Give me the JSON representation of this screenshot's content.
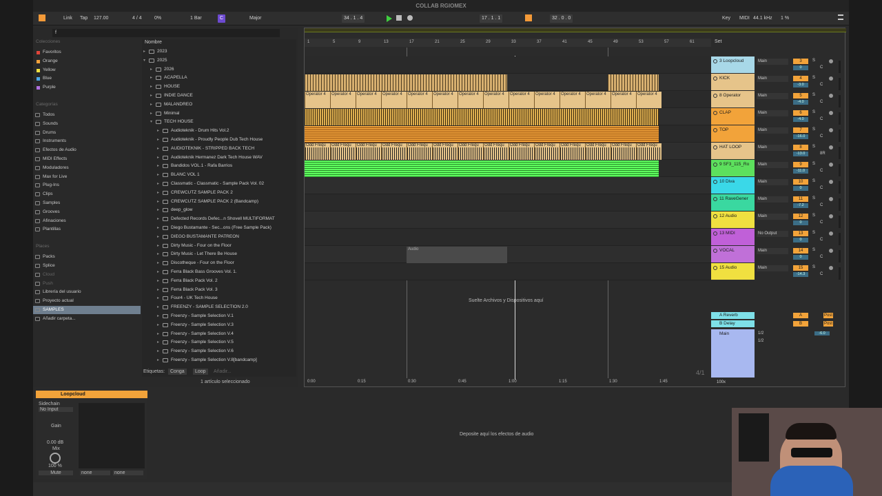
{
  "title": "COLLAB RGIOMEX",
  "control": {
    "link": "Link",
    "tap": "Tap",
    "tempo": "127.00",
    "sig": "4 / 4",
    "pct": "0%",
    "bar": "1 Bar",
    "key_root": "C",
    "scale": "Major",
    "pos": "34 .   1 .   4",
    "loop_start": "17 .   1 .   1",
    "loop_len": "32 .   0 .   0",
    "key": "Key",
    "midi": "MIDI",
    "rate": "44.1 kHz",
    "cpu": "1 %"
  },
  "browser": {
    "collections_title": "Colecciones",
    "collections": [
      {
        "label": "Favoritos",
        "color": "#e0453a"
      },
      {
        "label": "Orange",
        "color": "#f3a23b"
      },
      {
        "label": "Yellow",
        "color": "#f0e040"
      },
      {
        "label": "Blue",
        "color": "#4aa8e8"
      },
      {
        "label": "Purple",
        "color": "#b070e0"
      }
    ],
    "categories_title": "Categorías",
    "categories": [
      "Todos",
      "Sounds",
      "Drums",
      "Instruments",
      "Efectos de Audio",
      "MIDI Effects",
      "Moduladores",
      "Max for Live",
      "Plug-Ins",
      "Clips",
      "Samples",
      "Grooves",
      "Afinaciones",
      "Plantillas"
    ],
    "places_title": "Places",
    "places": [
      "Packs",
      "Splice",
      "Cloud",
      "Push",
      "Librería del usuario",
      "Proyecto actual",
      "SAMPLES",
      "Añadir carpeta..."
    ],
    "search_value": "f",
    "col_name": "Nombre",
    "tree": [
      {
        "t": "2023",
        "d": 0
      },
      {
        "t": "2025",
        "d": 0,
        "o": 1
      },
      {
        "t": "2026",
        "d": 1
      },
      {
        "t": "ACAPELLA",
        "d": 1
      },
      {
        "t": "HOUSE",
        "d": 1
      },
      {
        "t": "INDIE DANCE",
        "d": 1
      },
      {
        "t": "MALANDREO",
        "d": 1
      },
      {
        "t": "Minimal",
        "d": 1
      },
      {
        "t": "TECH HOUSE",
        "d": 1,
        "o": 1
      },
      {
        "t": "Audioteknik - Drum Hits Vol.2",
        "d": 2
      },
      {
        "t": "Audioteknik - Proudly People Dub Tech House",
        "d": 2
      },
      {
        "t": "AUDIOTEKNIK - STRIPPED BACK TECH",
        "d": 2
      },
      {
        "t": "Audioteknik Hermanez Dark Tech House WAV",
        "d": 2
      },
      {
        "t": "Bandidos VOL.1 - Rafa Barrios",
        "d": 2
      },
      {
        "t": "BLANC VOL 1",
        "d": 2
      },
      {
        "t": "Classmatic - Classmatic - Sample Pack Vol. 02",
        "d": 2
      },
      {
        "t": "CREWCUTZ SAMPLE PACK 2",
        "d": 2
      },
      {
        "t": "CREWCUTZ SAMPLE PACK 2 (Bandcamp)",
        "d": 2
      },
      {
        "t": "deep_glow",
        "d": 2
      },
      {
        "t": "Defected Records Defec...n Shovell MULTIFORMAT",
        "d": 2
      },
      {
        "t": "Diego Bustamante - Sec...ons (Free Sample Pack)",
        "d": 2
      },
      {
        "t": "DIEGO BUSTAMANTE PATREON",
        "d": 2
      },
      {
        "t": "Dirty Music - Four on the Floor",
        "d": 2
      },
      {
        "t": "Dirty Music - Let There Be House",
        "d": 2
      },
      {
        "t": "Discotheque - Four on the Floor",
        "d": 2
      },
      {
        "t": "Ferra Black Bass Grooves Vol. 1.",
        "d": 2
      },
      {
        "t": "Ferra Black Pack Vol. 2",
        "d": 2
      },
      {
        "t": "Ferra Black Pack Vol. 3",
        "d": 2
      },
      {
        "t": "Four4 - UK Tech House",
        "d": 2
      },
      {
        "t": "FREENZY - SAMPLE SELECTION 2.0",
        "d": 2
      },
      {
        "t": "Freenzy - Sample Selection V.1",
        "d": 2
      },
      {
        "t": "Freenzy - Sample Selection V.3",
        "d": 2
      },
      {
        "t": "Freenzy - Sample Selection V.4",
        "d": 2
      },
      {
        "t": "Freenzy - Sample Selection V.5",
        "d": 2
      },
      {
        "t": "Freenzy - Sample Selection V.6",
        "d": 2
      },
      {
        "t": "Freenzy - Sample Selection V.8[bandcamp]",
        "d": 2
      }
    ],
    "tags_label": "Etiquetas:",
    "tags": [
      "Conga",
      "Loop"
    ],
    "tags_add": "Añadir...",
    "status": "1 artículo seleccionado"
  },
  "arrangement": {
    "bars": [
      "1",
      "5",
      "9",
      "13",
      "17",
      "21",
      "25",
      "29",
      "33",
      "37",
      "41",
      "45",
      "49",
      "53",
      "57",
      "61"
    ],
    "times": [
      "0:00",
      "0:15",
      "0:30",
      "0:45",
      "1:00",
      "1:15",
      "1:30",
      "1:45"
    ],
    "clip_op": "Operator 4",
    "clip_odd": "Odd Frequ",
    "clip_audio": "Audio",
    "drop_hint": "Suelte Archivos y Dispositivos aquí",
    "ratio": "4/1",
    "set": "Set"
  },
  "tracks": [
    {
      "name": "3 Loopcloud",
      "color": "#a8d8e8",
      "out": "Main",
      "num": "3",
      "vol": "0",
      "pan": "C"
    },
    {
      "name": "KICK",
      "color": "#e6c48a",
      "out": "Main",
      "num": "4",
      "vol": "-3.0",
      "pan": "C"
    },
    {
      "name": "8 Operator",
      "color": "#e6c48a",
      "out": "Main",
      "num": "5",
      "vol": "-4.0",
      "pan": "C"
    },
    {
      "name": "CLAP",
      "color": "#f2a33a",
      "out": "Main",
      "num": "6",
      "vol": "-4.0",
      "pan": "C"
    },
    {
      "name": "TOP",
      "color": "#f2a33a",
      "out": "Main",
      "num": "7",
      "vol": "-16.0",
      "pan": "C"
    },
    {
      "name": "HAT LOOP",
      "color": "#e6c48a",
      "out": "Main",
      "num": "8",
      "vol": "-13.0",
      "pan": "8R"
    },
    {
      "name": "9 SF3_115_Ro",
      "color": "#5de05d",
      "out": "Main",
      "num": "9",
      "vol": "-11.0",
      "pan": "C"
    },
    {
      "name": "10 Diva",
      "color": "#3ad8e8",
      "out": "Main",
      "num": "10",
      "vol": "0",
      "pan": "C"
    },
    {
      "name": "11 RaveGener",
      "color": "#3ad8a0",
      "out": "Main",
      "num": "11",
      "vol": "-7.2",
      "pan": "C"
    },
    {
      "name": "12 Audio",
      "color": "#f0e040",
      "out": "Main",
      "num": "12",
      "vol": "0",
      "pan": "C"
    },
    {
      "name": "13 MIDI",
      "color": "#c060d8",
      "out": "No Output",
      "num": "13",
      "vol": "0",
      "pan": "C"
    },
    {
      "name": "VOCAL",
      "color": "#c070d8",
      "out": "Main",
      "num": "14",
      "vol": "0",
      "pan": "C"
    },
    {
      "name": "15 Audio",
      "color": "#f0e040",
      "out": "Main",
      "num": "15",
      "vol": "-14.3",
      "pan": "C"
    }
  ],
  "returns": [
    {
      "name": "A Reverb",
      "num": "A",
      "post": "Post"
    },
    {
      "name": "B Delay",
      "num": "B",
      "post": "Post"
    }
  ],
  "main": {
    "name": "Main",
    "v1": "1/2",
    "v2": "1/2",
    "vol": "-6.0",
    "zoom": "100x"
  },
  "device": {
    "name": "Loopcloud",
    "sidechain": "Sidechain",
    "input": "No Input",
    "gain": "Gain",
    "gain_val": "0.00 dB",
    "mix": "Mix",
    "mix_val": "100 %",
    "mute": "Mute",
    "none1": "none",
    "none2": "none"
  },
  "fx_drop": "Deposite aquí los efectos de audio"
}
